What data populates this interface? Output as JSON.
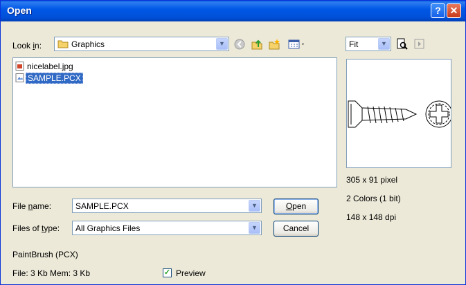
{
  "window": {
    "title": "Open"
  },
  "look_in": {
    "label": "Look in:",
    "access_key": "i",
    "value": "Graphics"
  },
  "files": [
    {
      "name": "nicelabel.jpg",
      "selected": false
    },
    {
      "name": "SAMPLE.PCX",
      "selected": true
    }
  ],
  "file_name": {
    "label": "File name:",
    "access_key": "n",
    "value": "SAMPLE.PCX"
  },
  "files_of_type": {
    "label": "Files of type:",
    "access_key": "t",
    "value": "All Graphics Files"
  },
  "buttons": {
    "open": "Open",
    "cancel": "Cancel"
  },
  "zoom": {
    "value": "Fit"
  },
  "image_info": {
    "dimensions": "305 x 91 pixel",
    "colors": "2 Colors (1 bit)",
    "dpi": "148 x 148 dpi"
  },
  "format": "PaintBrush (PCX)",
  "file_size": "File: 3 Kb  Mem: 3 Kb",
  "preview_checkbox": {
    "label": "Preview",
    "checked": true
  },
  "colors": {
    "titlebar": "#0058e6",
    "selection": "#316ac5",
    "face": "#ece9d8"
  }
}
